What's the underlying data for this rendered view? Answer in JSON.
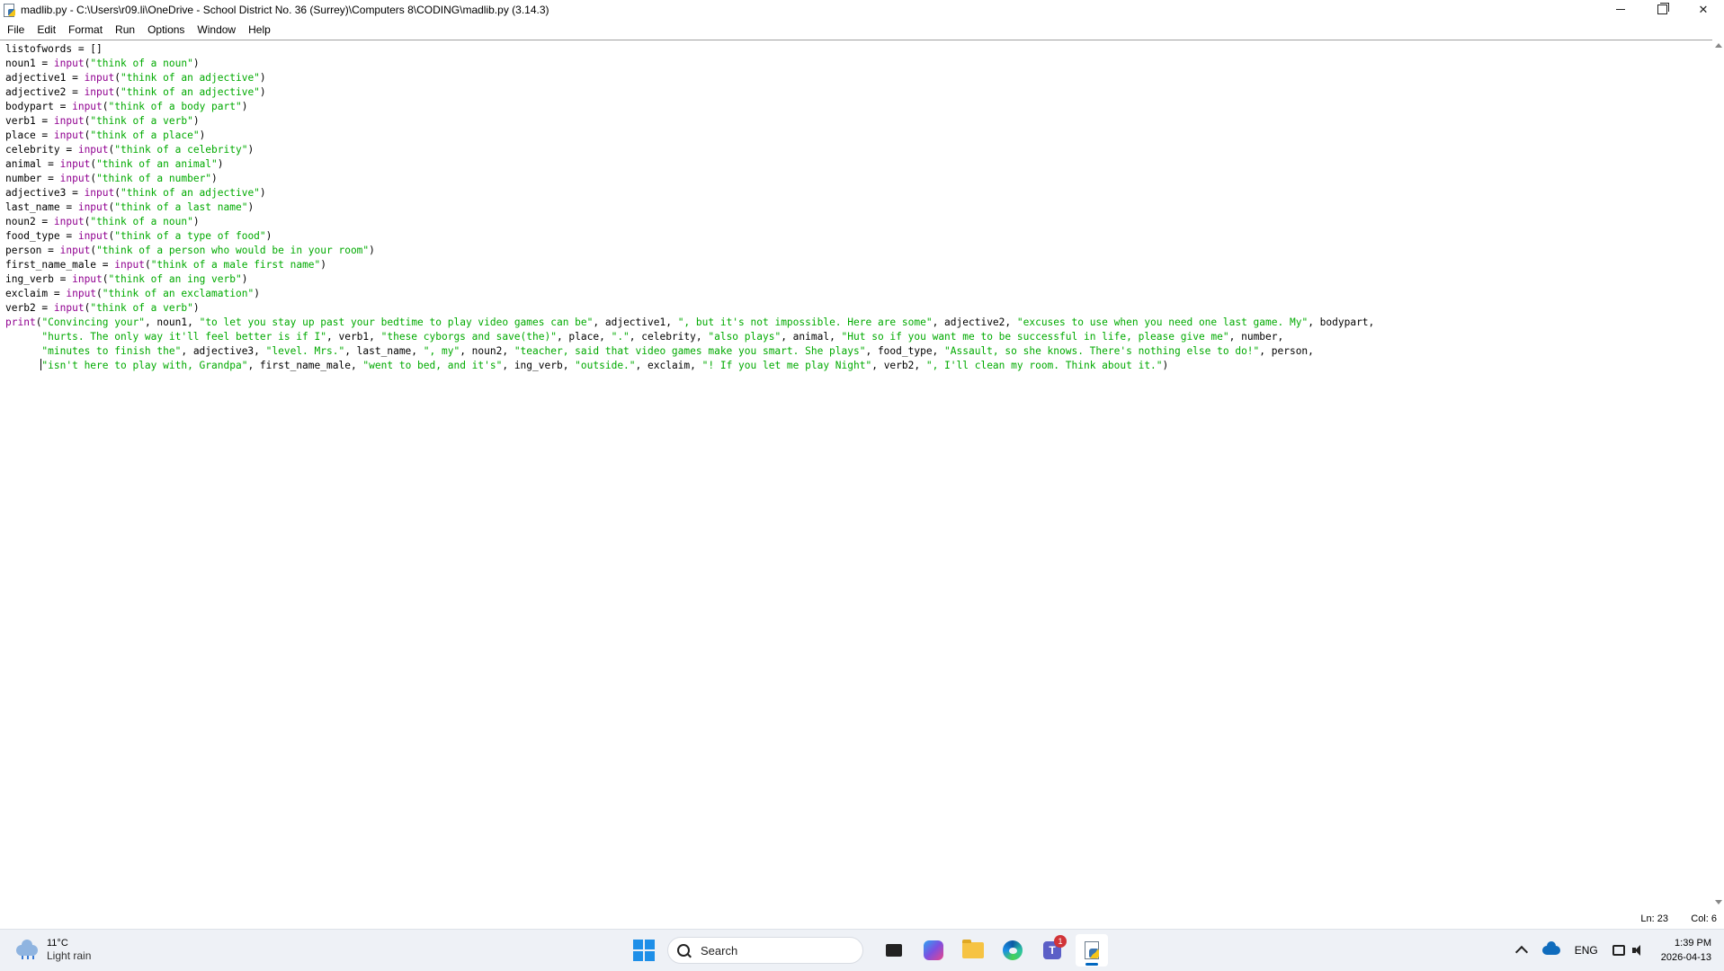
{
  "window": {
    "title": "madlib.py - C:\\Users\\r09.li\\OneDrive - School District No. 36 (Surrey)\\Computers 8\\CODING\\madlib.py (3.14.3)"
  },
  "menu": [
    "File",
    "Edit",
    "Format",
    "Run",
    "Options",
    "Window",
    "Help"
  ],
  "code_lines": [
    [
      [
        "t",
        "listofwords = []"
      ]
    ],
    [
      [
        "t",
        "noun1 = "
      ],
      [
        "k",
        "input"
      ],
      [
        "t",
        "("
      ],
      [
        "s",
        "\"think of a noun\""
      ],
      [
        "t",
        ")"
      ]
    ],
    [
      [
        "t",
        "adjective1 = "
      ],
      [
        "k",
        "input"
      ],
      [
        "t",
        "("
      ],
      [
        "s",
        "\"think of an adjective\""
      ],
      [
        "t",
        ")"
      ]
    ],
    [
      [
        "t",
        "adjective2 = "
      ],
      [
        "k",
        "input"
      ],
      [
        "t",
        "("
      ],
      [
        "s",
        "\"think of an adjective\""
      ],
      [
        "t",
        ")"
      ]
    ],
    [
      [
        "t",
        "bodypart = "
      ],
      [
        "k",
        "input"
      ],
      [
        "t",
        "("
      ],
      [
        "s",
        "\"think of a body part\""
      ],
      [
        "t",
        ")"
      ]
    ],
    [
      [
        "t",
        "verb1 = "
      ],
      [
        "k",
        "input"
      ],
      [
        "t",
        "("
      ],
      [
        "s",
        "\"think of a verb\""
      ],
      [
        "t",
        ")"
      ]
    ],
    [
      [
        "t",
        "place = "
      ],
      [
        "k",
        "input"
      ],
      [
        "t",
        "("
      ],
      [
        "s",
        "\"think of a place\""
      ],
      [
        "t",
        ")"
      ]
    ],
    [
      [
        "t",
        "celebrity = "
      ],
      [
        "k",
        "input"
      ],
      [
        "t",
        "("
      ],
      [
        "s",
        "\"think of a celebrity\""
      ],
      [
        "t",
        ")"
      ]
    ],
    [
      [
        "t",
        "animal = "
      ],
      [
        "k",
        "input"
      ],
      [
        "t",
        "("
      ],
      [
        "s",
        "\"think of an animal\""
      ],
      [
        "t",
        ")"
      ]
    ],
    [
      [
        "t",
        "number = "
      ],
      [
        "k",
        "input"
      ],
      [
        "t",
        "("
      ],
      [
        "s",
        "\"think of a number\""
      ],
      [
        "t",
        ")"
      ]
    ],
    [
      [
        "t",
        "adjective3 = "
      ],
      [
        "k",
        "input"
      ],
      [
        "t",
        "("
      ],
      [
        "s",
        "\"think of an adjective\""
      ],
      [
        "t",
        ")"
      ]
    ],
    [
      [
        "t",
        "last_name = "
      ],
      [
        "k",
        "input"
      ],
      [
        "t",
        "("
      ],
      [
        "s",
        "\"think of a last name\""
      ],
      [
        "t",
        ")"
      ]
    ],
    [
      [
        "t",
        "noun2 = "
      ],
      [
        "k",
        "input"
      ],
      [
        "t",
        "("
      ],
      [
        "s",
        "\"think of a noun\""
      ],
      [
        "t",
        ")"
      ]
    ],
    [
      [
        "t",
        "food_type = "
      ],
      [
        "k",
        "input"
      ],
      [
        "t",
        "("
      ],
      [
        "s",
        "\"think of a type of food\""
      ],
      [
        "t",
        ")"
      ]
    ],
    [
      [
        "t",
        "person = "
      ],
      [
        "k",
        "input"
      ],
      [
        "t",
        "("
      ],
      [
        "s",
        "\"think of a person who would be in your room\""
      ],
      [
        "t",
        ")"
      ]
    ],
    [
      [
        "t",
        "first_name_male = "
      ],
      [
        "k",
        "input"
      ],
      [
        "t",
        "("
      ],
      [
        "s",
        "\"think of a male first name\""
      ],
      [
        "t",
        ")"
      ]
    ],
    [
      [
        "t",
        "ing_verb = "
      ],
      [
        "k",
        "input"
      ],
      [
        "t",
        "("
      ],
      [
        "s",
        "\"think of an ing verb\""
      ],
      [
        "t",
        ")"
      ]
    ],
    [
      [
        "t",
        "exclaim = "
      ],
      [
        "k",
        "input"
      ],
      [
        "t",
        "("
      ],
      [
        "s",
        "\"think of an exclamation\""
      ],
      [
        "t",
        ")"
      ]
    ],
    [
      [
        "t",
        "verb2 = "
      ],
      [
        "k",
        "input"
      ],
      [
        "t",
        "("
      ],
      [
        "s",
        "\"think of a verb\""
      ],
      [
        "t",
        ")"
      ]
    ],
    [
      [
        "k",
        "print"
      ],
      [
        "t",
        "("
      ],
      [
        "s",
        "\"Convincing your\""
      ],
      [
        "t",
        ", noun1, "
      ],
      [
        "s",
        "\"to let you stay up past your bedtime to play video games can be\""
      ],
      [
        "t",
        ", adjective1, "
      ],
      [
        "s",
        "\", but it's not impossible. Here are some\""
      ],
      [
        "t",
        ", adjective2, "
      ],
      [
        "s",
        "\"excuses to use when you need one last game. My\""
      ],
      [
        "t",
        ", bodypart,"
      ]
    ],
    [
      [
        "t",
        "      "
      ],
      [
        "s",
        "\"hurts. The only way it'll feel better is if I\""
      ],
      [
        "t",
        ", verb1, "
      ],
      [
        "s",
        "\"these cyborgs and save(the)\""
      ],
      [
        "t",
        ", place, "
      ],
      [
        "s",
        "\".\""
      ],
      [
        "t",
        ", celebrity, "
      ],
      [
        "s",
        "\"also plays\""
      ],
      [
        "t",
        ", animal, "
      ],
      [
        "s",
        "\"Hut so if you want me to be successful in life, please give me\""
      ],
      [
        "t",
        ", number,"
      ]
    ],
    [
      [
        "t",
        "      "
      ],
      [
        "s",
        "\"minutes to finish the\""
      ],
      [
        "t",
        ", adjective3, "
      ],
      [
        "s",
        "\"level. Mrs.\""
      ],
      [
        "t",
        ", last_name, "
      ],
      [
        "s",
        "\", my\""
      ],
      [
        "t",
        ", noun2, "
      ],
      [
        "s",
        "\"teacher, said that video games make you smart. She plays\""
      ],
      [
        "t",
        ", food_type, "
      ],
      [
        "s",
        "\"Assault, so she knows. There's nothing else to do!\""
      ],
      [
        "t",
        ", person,"
      ]
    ],
    [
      [
        "t",
        "      "
      ],
      [
        "c",
        ""
      ],
      [
        "s",
        "\"isn't here to play with, Grandpa\""
      ],
      [
        "t",
        ", first_name_male, "
      ],
      [
        "s",
        "\"went to bed, and it's\""
      ],
      [
        "t",
        ", ing_verb, "
      ],
      [
        "s",
        "\"outside.\""
      ],
      [
        "t",
        ", exclaim, "
      ],
      [
        "s",
        "\"! If you let me play Night\""
      ],
      [
        "t",
        ", verb2, "
      ],
      [
        "s",
        "\", I'll clean my room. Think about it.\""
      ],
      [
        "t",
        ")"
      ]
    ]
  ],
  "status": {
    "line": "Ln: 23",
    "col": "Col: 6"
  },
  "taskbar": {
    "weather_temp": "11°C",
    "weather_condition": "Light rain",
    "search_label": "Search",
    "teams_badge": "1",
    "language": "ENG",
    "time": "1:39 PM",
    "date": "2026-04-13"
  },
  "colors": {
    "keyword": "#900090",
    "string": "#00aa00",
    "taskbar_bg": "#eef1f6"
  }
}
